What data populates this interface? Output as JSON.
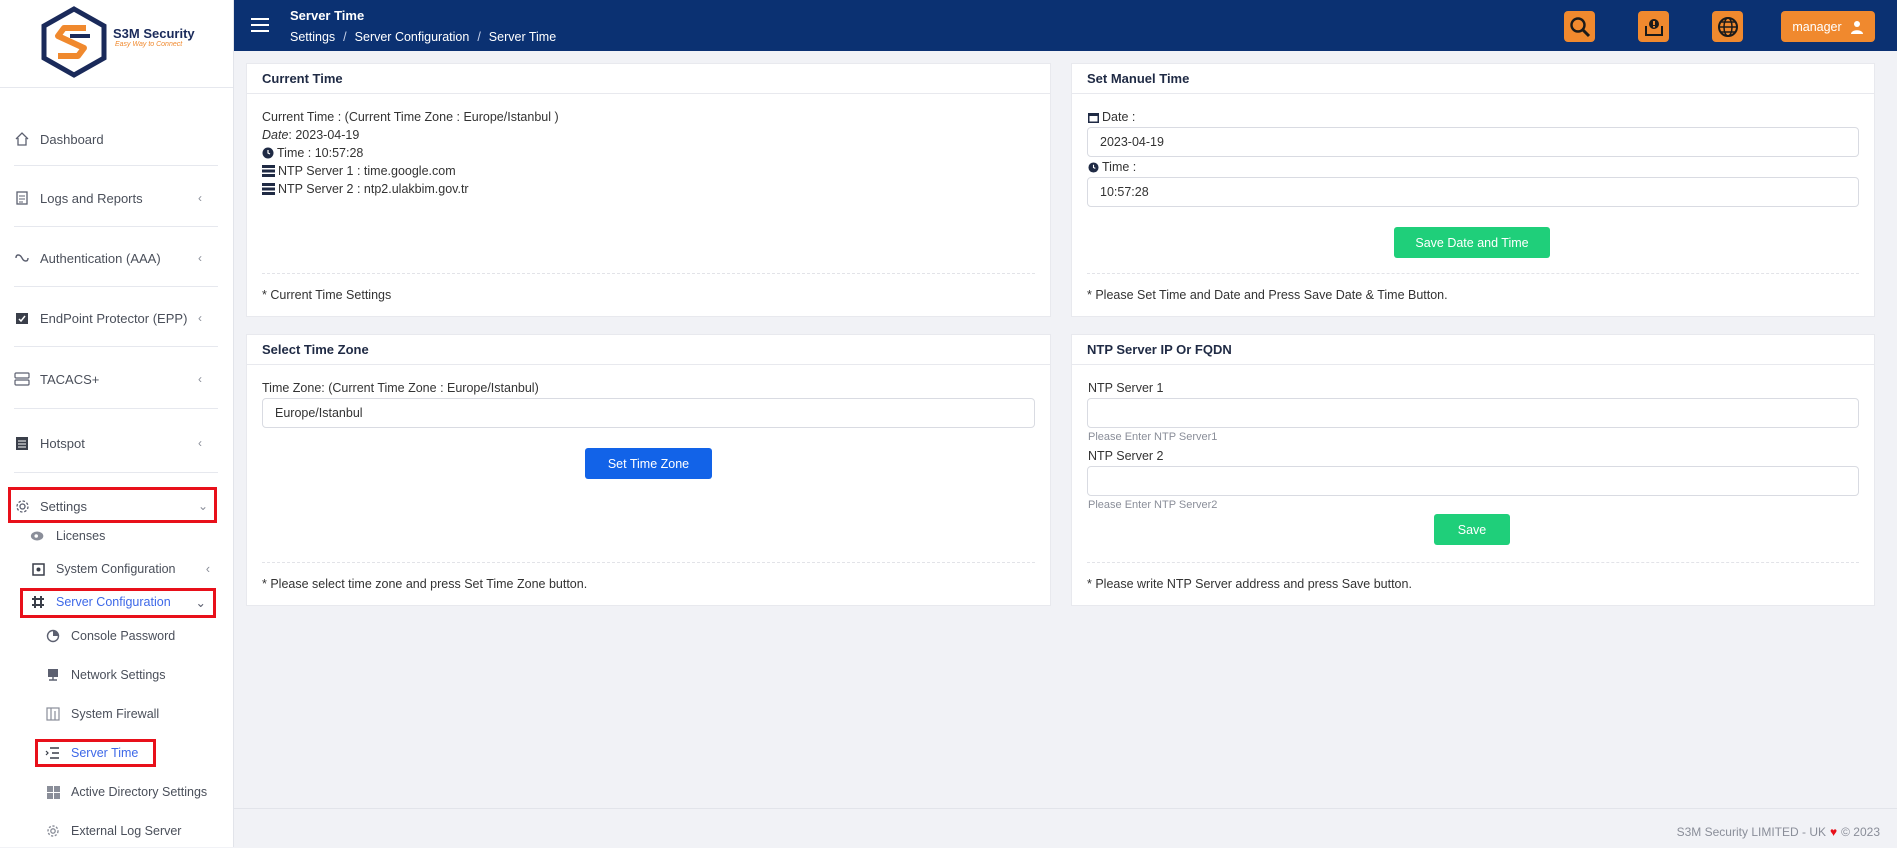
{
  "brand": {
    "name": "S3M Security",
    "tagline": "Easy Way to Connect"
  },
  "header": {
    "title": "Server Time",
    "breadcrumb": [
      "Settings",
      "Server Configuration",
      "Server Time"
    ],
    "breadcrumb_separator": "/",
    "user_label": "manager",
    "icons": [
      "search-icon",
      "notification-icon",
      "globe-icon",
      "user-icon"
    ]
  },
  "sidebar": {
    "items": [
      {
        "label": "Dashboard",
        "icon": "home-icon"
      },
      {
        "label": "Logs and Reports",
        "icon": "report-icon",
        "chevron": "‹"
      },
      {
        "label": "Authentication (AAA)",
        "icon": "auth-icon",
        "chevron": "‹"
      },
      {
        "label": "EndPoint Protector (EPP)",
        "icon": "calendar-check-icon",
        "chevron": "‹"
      },
      {
        "label": "TACACS+",
        "icon": "server-icon",
        "chevron": "‹"
      },
      {
        "label": "Hotspot",
        "icon": "list-icon",
        "chevron": "‹"
      },
      {
        "label": "Settings",
        "icon": "gear-icon",
        "chevron": "⌄"
      }
    ],
    "settings_children": [
      {
        "label": "Licenses",
        "icon": "license-icon"
      },
      {
        "label": "System Configuration",
        "icon": "system-icon",
        "chevron": "‹"
      },
      {
        "label": "Server Configuration",
        "icon": "slack-icon",
        "chevron": "⌄"
      }
    ],
    "server_config_children": [
      {
        "label": "Console Password",
        "icon": "console-icon"
      },
      {
        "label": "Network Settings",
        "icon": "network-icon"
      },
      {
        "label": "System Firewall",
        "icon": "firewall-icon"
      },
      {
        "label": "Server Time",
        "icon": "server-time-icon"
      },
      {
        "label": "Active Directory Settings",
        "icon": "windows-icon"
      },
      {
        "label": "External Log Server",
        "icon": "cog-icon"
      }
    ]
  },
  "current_time": {
    "title": "Current Time",
    "zone_line": "Current Time : (Current Time Zone : Europe/Istanbul )",
    "date_label": "Date",
    "date_value": " : 2023-04-19",
    "time_line": "Time : 10:57:28",
    "ntp1_line": "NTP Server 1 : time.google.com",
    "ntp2_line": "NTP Server 2 : ntp2.ulakbim.gov.tr",
    "footer": "* Current Time Settings"
  },
  "manual_time": {
    "title": "Set Manuel Time",
    "date_label": "Date :",
    "date_value": "2023-04-19",
    "time_label": "Time :",
    "time_value": "10:57:28",
    "save_label": "Save Date and Time",
    "footer": "* Please Set Time and Date and Press Save Date & Time Button."
  },
  "time_zone": {
    "title": "Select Time Zone",
    "label": "Time Zone: (Current Time Zone : Europe/Istanbul)",
    "value": "Europe/Istanbul",
    "button_label": "Set Time Zone",
    "footer": "* Please select time zone and press Set Time Zone button."
  },
  "ntp": {
    "title": "NTP Server IP Or FQDN",
    "server1_label": "NTP Server 1",
    "server1_value": "",
    "server1_hint": "Please Enter NTP Server1",
    "server2_label": "NTP Server 2",
    "server2_value": "",
    "server2_hint": "Please Enter NTP Server2",
    "save_label": "Save",
    "footer": "* Please write NTP Server address and press Save button."
  },
  "footer": {
    "text": "S3M Security LIMITED - UK",
    "heart": "♥",
    "year": "© 2023"
  },
  "colors": {
    "header_bg": "#0b3172",
    "accent_orange": "#f0892e",
    "green_button": "#1fcf7a",
    "blue_button": "#1263e8",
    "active_link": "#3d68e8",
    "highlight_red": "#e8101a"
  }
}
